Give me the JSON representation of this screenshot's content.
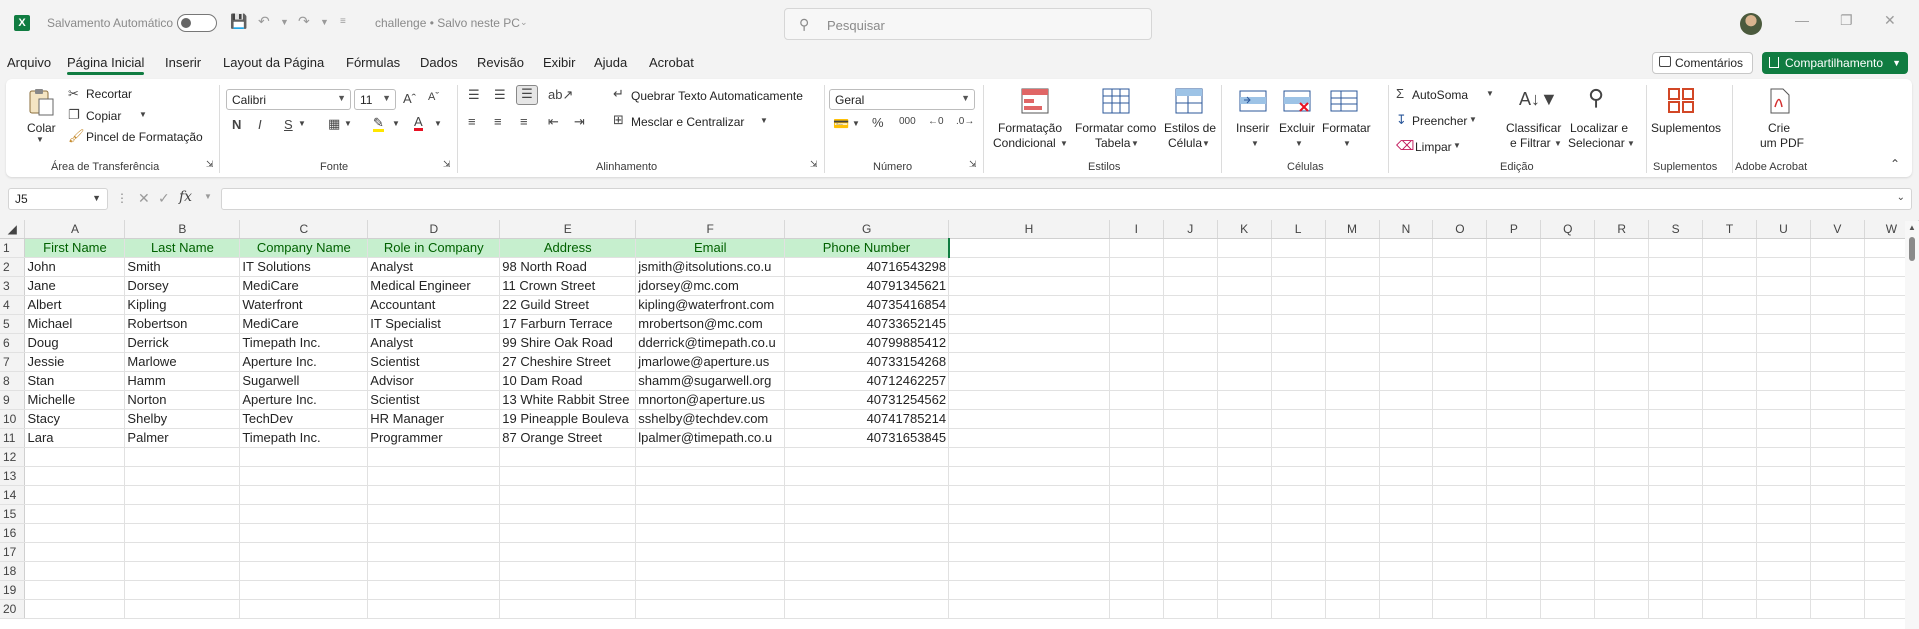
{
  "titlebar": {
    "autosave_label": "Salvamento Automático",
    "doc_title": "challenge • Salvo neste PC",
    "search_placeholder": "Pesquisar"
  },
  "menu": {
    "tabs": [
      "Arquivo",
      "Página Inicial",
      "Inserir",
      "Layout da Página",
      "Fórmulas",
      "Dados",
      "Revisão",
      "Exibir",
      "Ajuda",
      "Acrobat"
    ],
    "active_tab": "Página Inicial",
    "comments_label": "Comentários",
    "share_label": "Compartilhamento"
  },
  "ribbon": {
    "clipboard": {
      "paste": "Colar",
      "cut": "Recortar",
      "copy": "Copiar",
      "format_painter": "Pincel de Formatação",
      "group": "Área de Transferência"
    },
    "font": {
      "name": "Calibri",
      "size": "11",
      "group": "Fonte"
    },
    "alignment": {
      "wrap": "Quebrar Texto Automaticamente",
      "merge": "Mesclar e Centralizar",
      "group": "Alinhamento"
    },
    "number": {
      "format": "Geral",
      "group": "Número"
    },
    "styles": {
      "conditional_1": "Formatação",
      "conditional_2": "Condicional",
      "table_1": "Formatar como",
      "table_2": "Tabela",
      "cell_1": "Estilos de",
      "cell_2": "Célula",
      "group": "Estilos"
    },
    "cells": {
      "insert": "Inserir",
      "delete": "Excluir",
      "format": "Formatar",
      "group": "Células"
    },
    "editing": {
      "autosum": "AutoSoma",
      "fill": "Preencher",
      "clear": "Limpar",
      "sort_1": "Classificar",
      "sort_2": "e Filtrar",
      "find_1": "Localizar e",
      "find_2": "Selecionar",
      "group": "Edição"
    },
    "addins": {
      "label": "Suplementos",
      "group": "Suplementos"
    },
    "acrobat": {
      "label_1": "Crie",
      "label_2": "um PDF",
      "group": "Adobe Acrobat"
    }
  },
  "formula_bar": {
    "name_box": "J5",
    "fx": "fx",
    "content": ""
  },
  "sheet": {
    "columns": [
      "A",
      "B",
      "C",
      "D",
      "E",
      "F",
      "G",
      "H",
      "I",
      "J",
      "K",
      "L",
      "M",
      "N",
      "O",
      "P",
      "Q",
      "R",
      "S",
      "T",
      "U",
      "V",
      "W"
    ],
    "header_row": [
      "First Name",
      "Last Name",
      "Company Name",
      "Role in Company",
      "Address",
      "Email",
      "Phone Number"
    ],
    "rows": [
      [
        "John",
        "Smith",
        "IT Solutions",
        "Analyst",
        "98 North Road",
        "jsmith@itsolutions.co.u",
        "40716543298"
      ],
      [
        "Jane",
        "Dorsey",
        "MediCare",
        "Medical Engineer",
        "11 Crown Street",
        "jdorsey@mc.com",
        "40791345621"
      ],
      [
        "Albert",
        "Kipling",
        "Waterfront",
        "Accountant",
        "22 Guild Street",
        "kipling@waterfront.com",
        "40735416854"
      ],
      [
        "Michael",
        "Robertson",
        "MediCare",
        "IT Specialist",
        "17 Farburn Terrace",
        "mrobertson@mc.com",
        "40733652145"
      ],
      [
        "Doug",
        "Derrick",
        "Timepath Inc.",
        "Analyst",
        "99 Shire Oak Road",
        "dderrick@timepath.co.u",
        "40799885412"
      ],
      [
        "Jessie",
        "Marlowe",
        "Aperture Inc.",
        "Scientist",
        "27 Cheshire Street",
        "jmarlowe@aperture.us",
        "40733154268"
      ],
      [
        "Stan",
        "Hamm",
        "Sugarwell",
        "Advisor",
        "10 Dam Road",
        "shamm@sugarwell.org",
        "40712462257"
      ],
      [
        "Michelle",
        "Norton",
        "Aperture Inc.",
        "Scientist",
        "13 White Rabbit Stree",
        "mnorton@aperture.us",
        "40731254562"
      ],
      [
        "Stacy",
        "Shelby",
        "TechDev",
        "HR Manager",
        "19 Pineapple Bouleva",
        "sshelby@techdev.com",
        "40741785214"
      ],
      [
        "Lara",
        "Palmer",
        "Timepath Inc.",
        "Programmer",
        "87 Orange Street",
        "lpalmer@timepath.co.u",
        "40731653845"
      ]
    ],
    "row_numbers": [
      "1",
      "2",
      "3",
      "4",
      "5",
      "6",
      "7",
      "8",
      "9",
      "10",
      "11",
      "12",
      "13",
      "14",
      "15",
      "16",
      "17",
      "18",
      "19",
      "20"
    ],
    "header_fill": "#c6efce",
    "header_text_color": "#006100"
  },
  "colors": {
    "accent": "#107c41"
  }
}
